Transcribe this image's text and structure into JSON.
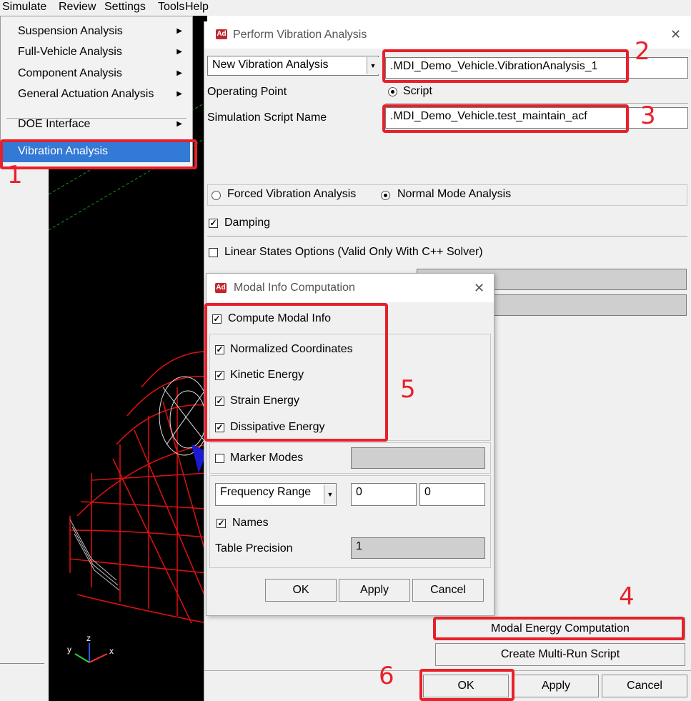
{
  "menubar": {
    "items": [
      "Simulate",
      "Review",
      "Settings",
      "Tools",
      "Help"
    ]
  },
  "dropdown": {
    "items": [
      {
        "label": "Suspension Analysis",
        "submenu": true
      },
      {
        "label": "Full-Vehicle Analysis",
        "submenu": true
      },
      {
        "label": "Component Analysis",
        "submenu": true
      },
      {
        "label": "General Actuation Analysis",
        "submenu": true
      },
      {
        "label": "DOE Interface",
        "submenu": true
      },
      {
        "label": "Vibration Analysis",
        "submenu": false
      }
    ]
  },
  "main_dialog": {
    "title": "Perform Vibration Analysis",
    "logo": "Ad",
    "mode_select": "New Vibration Analysis",
    "analysis_name": ".MDI_Demo_Vehicle.VibrationAnalysis_1",
    "operating_point_label": "Operating Point",
    "operating_point_value": "Script",
    "script_name_label": "Simulation Script Name",
    "script_name_value": ".MDI_Demo_Vehicle.test_maintain_acf",
    "forced_vibration": "Forced Vibration Analysis",
    "normal_mode": "Normal Mode Analysis",
    "damping": "Damping",
    "linear_states": "Linear States Options (Valid Only With C++ Solver)",
    "modal_energy_button": "Modal Energy Computation",
    "multi_run_button": "Create Multi-Run Script",
    "ok": "OK",
    "apply": "Apply",
    "cancel": "Cancel"
  },
  "modal": {
    "title": "Modal Info Computation",
    "logo": "Ad",
    "compute_modal_info": "Compute Modal Info",
    "normalized_coordinates": "Normalized Coordinates",
    "kinetic_energy": "Kinetic Energy",
    "strain_energy": "Strain Energy",
    "dissipative_energy": "Dissipative Energy",
    "marker_modes": "Marker Modes",
    "frequency_select": "Frequency Range",
    "freq_from": "0",
    "freq_to": "0",
    "names": "Names",
    "table_precision_label": "Table Precision",
    "table_precision_value": "1",
    "ok": "OK",
    "apply": "Apply",
    "cancel": "Cancel"
  },
  "annotations": [
    "1",
    "2",
    "3",
    "4",
    "5",
    "6"
  ],
  "axes": {
    "y": "y",
    "z": "z",
    "x": "x"
  },
  "colors": {
    "annotation_red": "#e8202a",
    "menu_highlight": "#3379d6",
    "wireframe_red": "#e01010"
  }
}
